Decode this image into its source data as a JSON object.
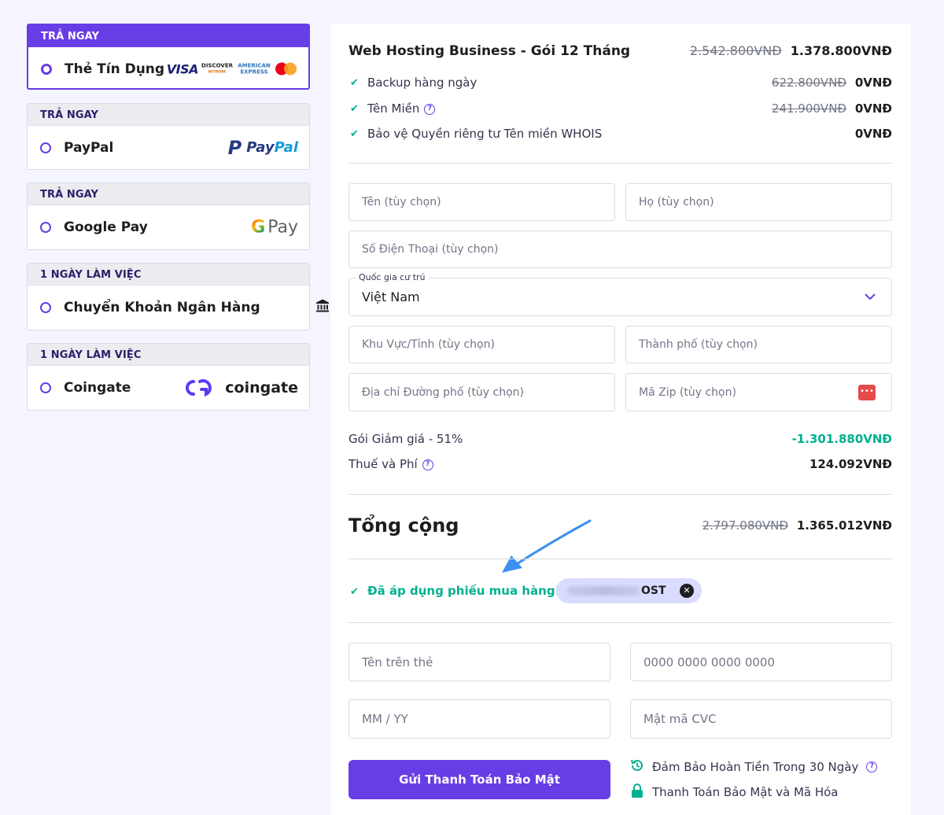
{
  "payment_methods": [
    {
      "tag": "TRẢ NGAY",
      "name": "Thẻ Tín Dụng",
      "selected": true,
      "logos": {
        "visa": "VISA",
        "discover": "DISCOVER",
        "discover_sub": "NETWORK",
        "amex": "AMERICAN EXPRESS"
      }
    },
    {
      "tag": "TRẢ NGAY",
      "name": "PayPal",
      "logo": {
        "p": "P",
        "pay": "Pay",
        "pal": "Pal"
      }
    },
    {
      "tag": "TRẢ NGAY",
      "name": "Google Pay",
      "logo": {
        "g": "G",
        "pay": "Pay"
      }
    },
    {
      "tag": "1 NGÀY LÀM VIỆC",
      "name": "Chuyển Khoản Ngân Hàng",
      "icon": "bank-icon"
    },
    {
      "tag": "1 NGÀY LÀM VIỆC",
      "name": "Coingate",
      "logo": {
        "mark": "CG",
        "text": "coingate"
      }
    }
  ],
  "order": {
    "product": "Web Hosting Business - Gói 12 Tháng",
    "product_old_price": "2.542.800VNĐ",
    "product_price": "1.378.800VNĐ",
    "features": [
      {
        "label": "Backup hàng ngày",
        "old_price": "622.800VNĐ",
        "price": "0VNĐ"
      },
      {
        "label": "Tên Miền",
        "old_price": "241.900VNĐ",
        "price": "0VNĐ",
        "help": true
      },
      {
        "label": "Bảo vệ Quyền riêng tư Tên miền WHOIS",
        "old_price": "",
        "price": "0VNĐ"
      }
    ]
  },
  "form": {
    "first_name_placeholder": "Tên (tùy chọn)",
    "last_name_placeholder": "Họ (tùy chọn)",
    "phone_placeholder": "Số Điện Thoại (tùy chọn)",
    "country_label": "Quốc gia cư trú",
    "country_value": "Việt Nam",
    "region_placeholder": "Khu Vực/Tỉnh (tùy chọn)",
    "city_placeholder": "Thành phố (tùy chọn)",
    "street_placeholder": "Địa chỉ Đường phố (tùy chọn)",
    "zip_placeholder": "Mã Zip (tùy chọn)",
    "zip_icon_text": "•••"
  },
  "summary": {
    "discount_label": "Gói Giảm giá - 51%",
    "discount_value": "-1.301.880VNĐ",
    "tax_label": "Thuế và Phí",
    "tax_value": "124.092VNĐ",
    "total_label": "Tổng cộng",
    "total_old": "2.797.080VNĐ",
    "total_value": "1.365.012VNĐ"
  },
  "coupon": {
    "applied_text": "Đã áp dụng phiếu mua hàng!",
    "code_visible": "OST",
    "remove_icon": "close-icon"
  },
  "card": {
    "name_placeholder": "Tên trên thẻ",
    "number_placeholder": "0000 0000 0000 0000",
    "expiry_placeholder": "MM / YY",
    "cvc_placeholder": "Mật mã CVC"
  },
  "submit_label": "Gửi Thanh Toán Bảo Mật",
  "assurances": [
    {
      "icon": "history-icon",
      "text": "Đảm Bảo Hoàn Tiền Trong 30 Ngày",
      "help": true
    },
    {
      "icon": "lock-icon",
      "text": "Thanh Toán Bảo Mật và Mã Hóa"
    }
  ],
  "colors": {
    "accent": "#673de6",
    "success": "#00b090",
    "arrow": "#3d8ff0"
  }
}
